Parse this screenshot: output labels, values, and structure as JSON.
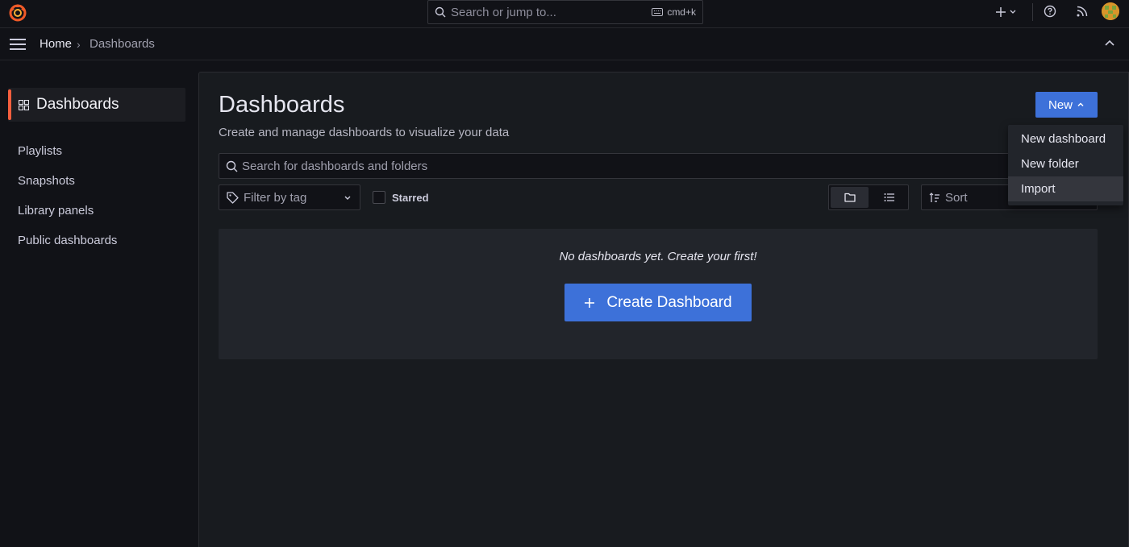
{
  "topbar": {
    "search_placeholder": "Search or jump to...",
    "shortcut_label": "cmd+k"
  },
  "breadcrumb": {
    "home": "Home",
    "separator": "›",
    "current": "Dashboards"
  },
  "sidenav": {
    "active_label": "Dashboards",
    "items": [
      {
        "label": "Playlists"
      },
      {
        "label": "Snapshots"
      },
      {
        "label": "Library panels"
      },
      {
        "label": "Public dashboards"
      }
    ]
  },
  "page": {
    "title": "Dashboards",
    "subtitle": "Create and manage dashboards to visualize your data",
    "new_button": "New",
    "search_placeholder": "Search for dashboards and folders",
    "tag_filter_placeholder": "Filter by tag",
    "starred_label": "Starred",
    "starred_checked": false,
    "sort_placeholder": "Sort",
    "view_mode": "folders"
  },
  "empty_state": {
    "message": "No dashboards yet. Create your first!",
    "create_button": "Create Dashboard"
  },
  "new_menu": {
    "items": [
      {
        "label": "New dashboard"
      },
      {
        "label": "New folder"
      },
      {
        "label": "Import"
      }
    ],
    "highlighted": "Import"
  },
  "colors": {
    "background": "#111217",
    "panel": "#181b1f",
    "primary": "#3d71d9",
    "accent": "#f55f3e",
    "text": "#ccccdc"
  }
}
